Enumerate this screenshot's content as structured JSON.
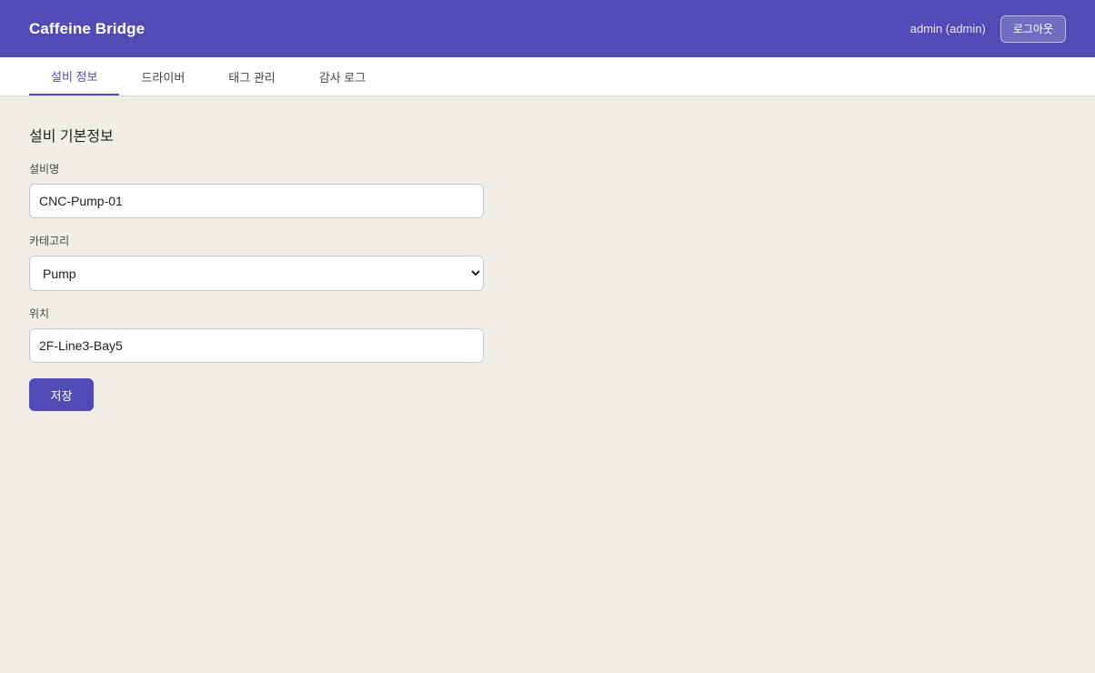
{
  "header": {
    "title": "Caffeine Bridge",
    "user": "admin (admin)",
    "logout_label": "로그아웃"
  },
  "tabs": [
    {
      "label": "설비 정보",
      "active": true
    },
    {
      "label": "드라이버",
      "active": false
    },
    {
      "label": "태그 관리",
      "active": false
    },
    {
      "label": "감사 로그",
      "active": false
    }
  ],
  "form": {
    "section_title": "설비 기본정보",
    "name_label": "설비명",
    "name_value": "CNC-Pump-01",
    "category_label": "카테고리",
    "category_value": "Pump",
    "location_label": "위치",
    "location_value": "2F-Line3-Bay5",
    "save_label": "저장"
  },
  "colors": {
    "accent": "#534bb5",
    "background": "#f1eee8"
  }
}
